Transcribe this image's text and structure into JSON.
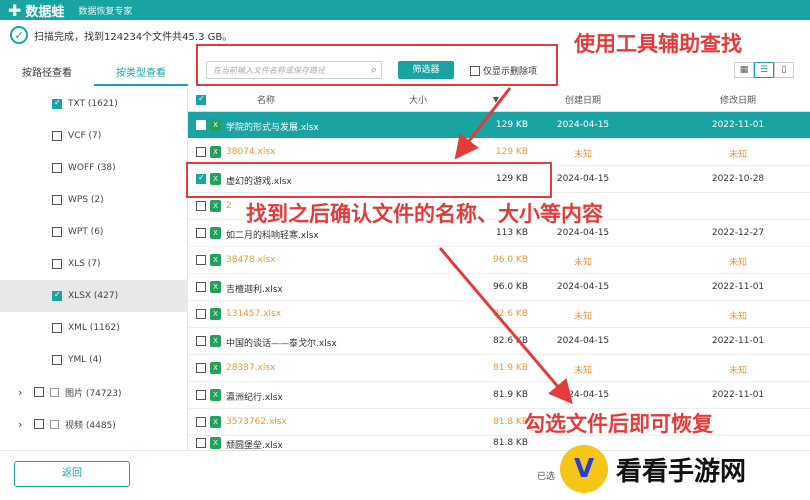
{
  "app": {
    "name": "数据蛙",
    "subtitle": "数据恢复专家"
  },
  "status": "扫描完成，找到124234个文件共45.3 GB。",
  "search": {
    "placeholder": "在当前输入文件名称或保存路径"
  },
  "filter_button": "筛选器",
  "show_deleted_label": "仅显示删除项",
  "annotations": {
    "tool_hint": "使用工具辅助查找",
    "confirm_hint": "找到之后确认文件的名称、大小等内容",
    "check_hint": "勾选文件后即可恢复"
  },
  "tabs": [
    {
      "label": "按路径查看"
    },
    {
      "label": "按类型查看"
    }
  ],
  "sidebar": {
    "items": [
      {
        "label": "TXT (1621)"
      },
      {
        "label": "VCF (7)"
      },
      {
        "label": "WOFF (38)"
      },
      {
        "label": "WPS (2)"
      },
      {
        "label": "WPT (6)"
      },
      {
        "label": "XLS (7)"
      },
      {
        "label": "XLSX (427)"
      },
      {
        "label": "XML (1162)"
      },
      {
        "label": "YML (4)"
      },
      {
        "label": "图片 (74723)"
      },
      {
        "label": "视频 (4485)"
      }
    ]
  },
  "table": {
    "headers": {
      "name": "名称",
      "size": "大小",
      "created": "创建日期",
      "modified": "修改日期"
    },
    "rows": [
      {
        "name": "学院的形式与发展.xlsx",
        "size": "129 KB",
        "created": "2024-04-15",
        "modified": "2022-11-01"
      },
      {
        "name": "38074.xlsx",
        "size": "129 KB",
        "created": "未知",
        "modified": "未知"
      },
      {
        "name": "虚幻的游戏.xlsx",
        "size": "129 KB",
        "created": "2024-04-15",
        "modified": "2022-10-28"
      },
      {
        "name": "2",
        "size": "",
        "created": "",
        "modified": ""
      },
      {
        "name": "如二月的科响轻寒.xlsx",
        "size": "113 KB",
        "created": "2024-04-15",
        "modified": "2022-12-27"
      },
      {
        "name": "38478.xlsx",
        "size": "96.0 KB",
        "created": "未知",
        "modified": "未知"
      },
      {
        "name": "吉檀迦利.xlsx",
        "size": "96.0 KB",
        "created": "2024-04-15",
        "modified": "2022-11-01"
      },
      {
        "name": "131457.xlsx",
        "size": "82.6 KB",
        "created": "未知",
        "modified": "未知"
      },
      {
        "name": "中国的谈话——泰戈尔.xlsx",
        "size": "82.6 KB",
        "created": "2024-04-15",
        "modified": "2022-11-01"
      },
      {
        "name": "28387.xlsx",
        "size": "81.9 KB",
        "created": "未知",
        "modified": "未知"
      },
      {
        "name": "瀛洲纪行.xlsx",
        "size": "81.9 KB",
        "created": "2024-04-15",
        "modified": "2022-11-01"
      },
      {
        "name": "3573762.xlsx",
        "size": "81.8 KB",
        "created": "未知",
        "modified": "未知"
      },
      {
        "name": "颓圆堡垒.xlsx",
        "size": "81.8 KB",
        "created": "2024-04-15",
        "modified": "2022-11-01"
      }
    ]
  },
  "footer": {
    "back": "返回",
    "selected": "已选"
  },
  "watermark": {
    "text": "看看手游网",
    "logo_glyph": "V"
  }
}
